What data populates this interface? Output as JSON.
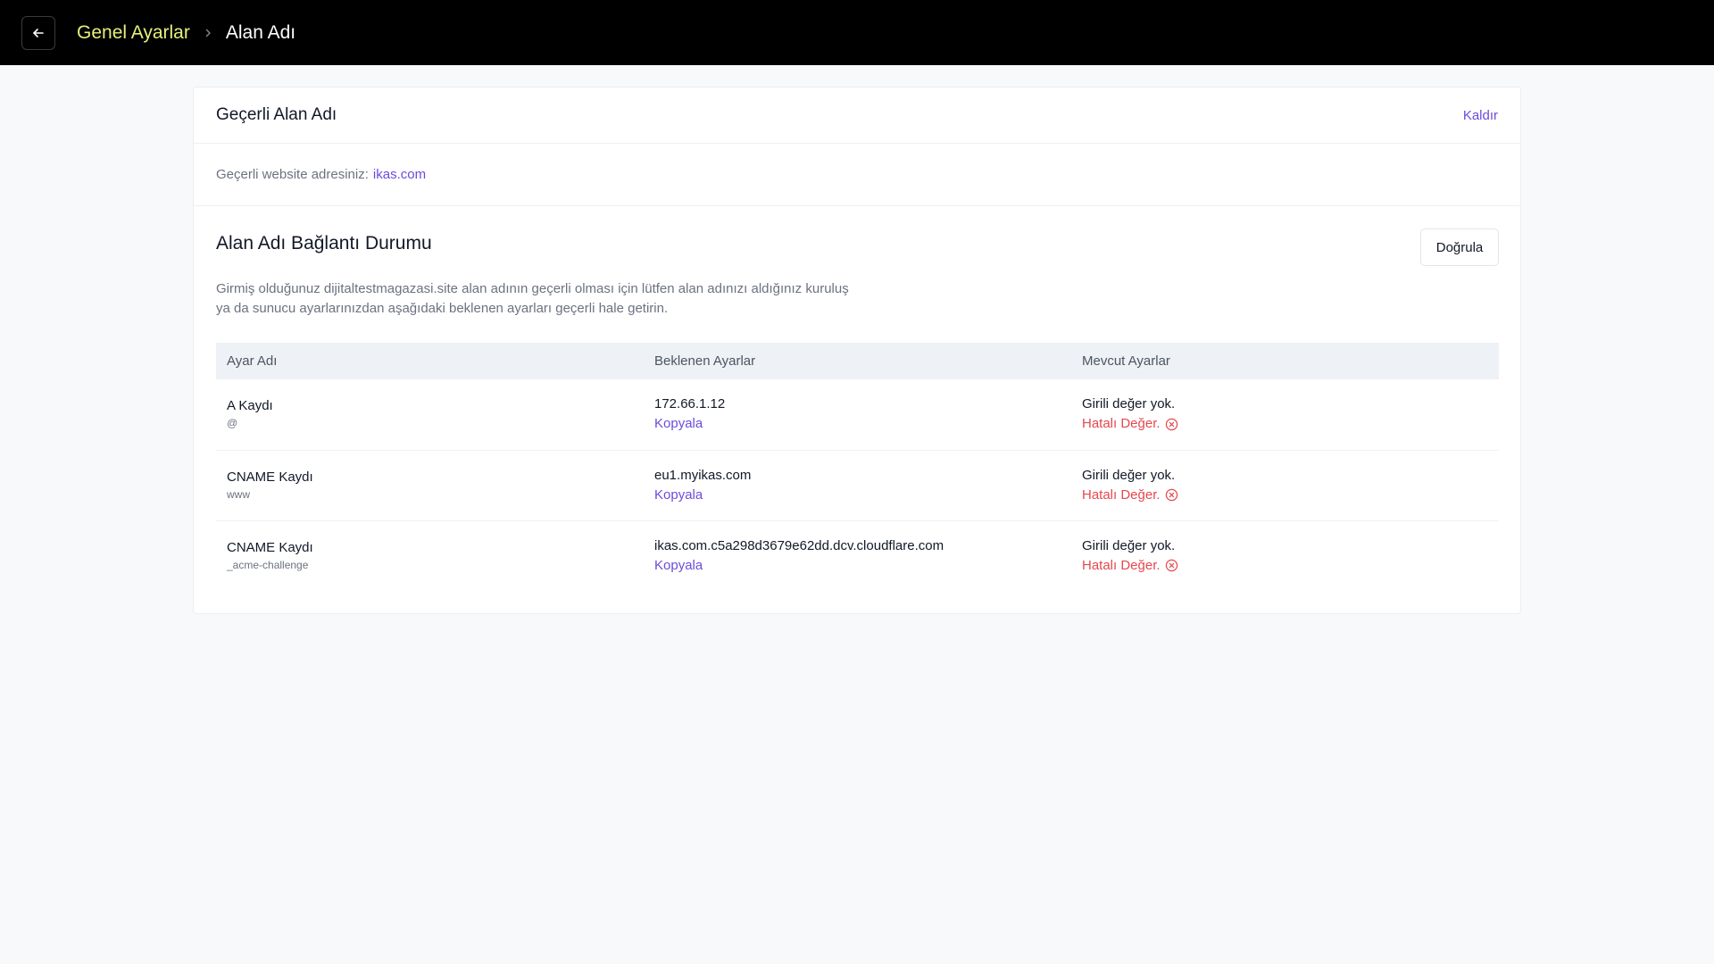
{
  "header": {
    "back_icon": "arrow-left-icon",
    "breadcrumb_parent": "Genel Ayarlar",
    "breadcrumb_current": "Alan Adı",
    "parent_color": "#e5f07a"
  },
  "current_domain": {
    "title": "Geçerli Alan Adı",
    "remove_label": "Kaldır",
    "description": "Geçerli website adresiniz:",
    "domain": "ikas.com"
  },
  "connection_status": {
    "title": "Alan Adı Bağlantı Durumu",
    "verify_label": "Doğrula",
    "description_line1": "Girmiş olduğunuz dijitaltestmagazasi.site alan adının geçerli olması için lütfen alan adınızı aldığınız kuruluş",
    "description_line2": "ya da sunucu ayarlarınızdan aşağıdaki beklenen ayarları geçerli hale getirin."
  },
  "table": {
    "columns": [
      "Ayar Adı",
      "Beklenen Ayarlar",
      "Mevcut Ayarlar"
    ],
    "rows": [
      {
        "name": "A Kaydı",
        "host": "@",
        "expected": "172.66.1.12",
        "copy_label": "Kopyala",
        "current": "Girili değer yok.",
        "error": "Hatalı Değer."
      },
      {
        "name": "CNAME Kaydı",
        "host": "www",
        "expected": "eu1.myikas.com",
        "copy_label": "Kopyala",
        "current": "Girili değer yok.",
        "error": "Hatalı Değer."
      },
      {
        "name": "CNAME Kaydı",
        "host": "_acme-challenge",
        "expected": "ikas.com.c5a298d3679e62dd.dcv.cloudflare.com",
        "copy_label": "Kopyala",
        "current": "Girili değer yok.",
        "error": "Hatalı Değer."
      }
    ]
  },
  "colors": {
    "accent": "#6d4bdc",
    "error": "#e5484d",
    "topbar": "#000000"
  }
}
